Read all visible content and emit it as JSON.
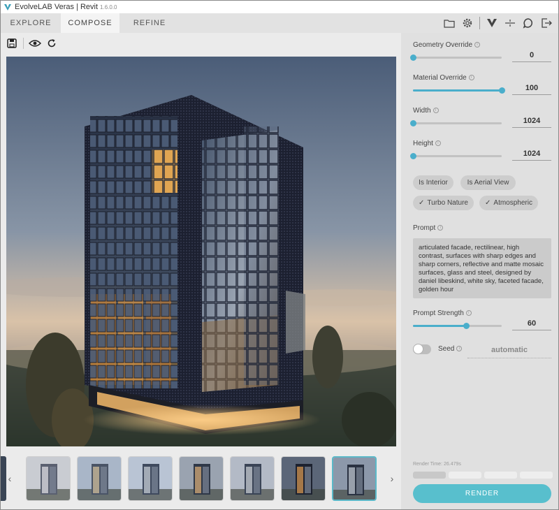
{
  "app": {
    "title": "EvolveLAB Veras | Revit",
    "version": "1.6.0.0"
  },
  "tabs": [
    {
      "label": "EXPLORE",
      "active": false
    },
    {
      "label": "COMPOSE",
      "active": true
    },
    {
      "label": "REFINE",
      "active": false
    }
  ],
  "top_icons": [
    "folder-icon",
    "gear-icon",
    "veras-logo-icon",
    "split-view-icon",
    "chat-icon",
    "exit-icon"
  ],
  "toolbar_icons": [
    "save-icon",
    "eye-icon",
    "refresh-icon"
  ],
  "controls": {
    "geometry_override": {
      "label": "Geometry Override",
      "value": "0",
      "fraction": 0.0
    },
    "material_override": {
      "label": "Material Override",
      "value": "100",
      "fraction": 1.0
    },
    "width": {
      "label": "Width",
      "value": "1024",
      "fraction": 0.0
    },
    "height": {
      "label": "Height",
      "value": "1024",
      "fraction": 0.0
    },
    "prompt_strength": {
      "label": "Prompt Strength",
      "value": "60",
      "fraction": 0.6
    }
  },
  "chips": [
    {
      "label": "Is Interior",
      "checked": false
    },
    {
      "label": "Is Aerial View",
      "checked": false
    },
    {
      "label": "Turbo Nature",
      "checked": true
    },
    {
      "label": "Atmospheric",
      "checked": true
    }
  ],
  "check_glyph": "✓",
  "prompt": {
    "label": "Prompt",
    "text": "articulated facade, rectilinear, high contrast, surfaces with sharp edges and sharp corners, reflective and matte mosaic surfaces, glass and steel, designed by daniel libeskind, white sky, faceted facade, golden hour"
  },
  "seed": {
    "label": "Seed",
    "enabled": false,
    "value": "automatic"
  },
  "render_time": "Render Time: 26.479s",
  "render_button": "RENDER",
  "nav": {
    "prev": "‹",
    "next": "›"
  },
  "thumbnails_count": 7,
  "selected_thumbnail": 6,
  "colors": {
    "accent": "#4aaecb",
    "render_button": "#58bfcd"
  }
}
